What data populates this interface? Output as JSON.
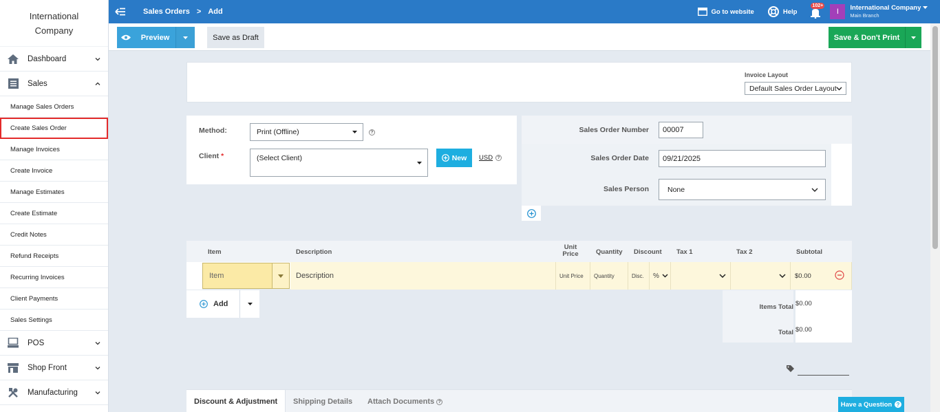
{
  "sidebar": {
    "brand": "International Company",
    "main": [
      {
        "label": "Dashboard",
        "icon": "home-icon"
      },
      {
        "label": "Sales",
        "icon": "list-icon"
      },
      {
        "label": "POS",
        "icon": "monitor-icon"
      },
      {
        "label": "Shop Front",
        "icon": "store-icon"
      },
      {
        "label": "Manufacturing",
        "icon": "tools-icon"
      }
    ],
    "sub": [
      "Manage Sales Orders",
      "Create Sales Order",
      "Manage Invoices",
      "Create Invoice",
      "Manage Estimates",
      "Create Estimate",
      "Credit Notes",
      "Refund Receipts",
      "Recurring Invoices",
      "Client Payments",
      "Sales Settings"
    ]
  },
  "topbar": {
    "crumb_parent": "Sales Orders",
    "crumb_sep": ">",
    "crumb_current": "Add",
    "go_to_website": "Go to website",
    "help": "Help",
    "notif_badge": "102+",
    "avatar": "I",
    "company_name": "International Company",
    "branch": "Main Branch"
  },
  "toolbar": {
    "preview": "Preview",
    "save_draft": "Save as Draft",
    "save_dont_print": "Save & Don't Print"
  },
  "invoice_layout": {
    "label": "Invoice Layout",
    "value": "Default Sales Order Layout"
  },
  "form": {
    "method_label": "Method:",
    "method_value": "Print (Offline)",
    "client_label": "Client",
    "client_req": "*",
    "client_value": "(Select Client)",
    "new_button": "New",
    "currency": "USD",
    "help_mark": "?"
  },
  "sales_order": {
    "number_label": "Sales Order Number",
    "number_value": "00007",
    "date_label": "Sales Order Date",
    "date_value": "09/21/2025",
    "person_label": "Sales Person",
    "person_value": "None"
  },
  "items": {
    "headers": {
      "item": "Item",
      "description": "Description",
      "unit_price": "Unit Price",
      "quantity": "Quantity",
      "discount": "Discount",
      "tax1": "Tax 1",
      "tax2": "Tax 2",
      "subtotal": "Subtotal"
    },
    "row": {
      "item_placeholder": "Item",
      "description_placeholder": "Description",
      "unit_price_placeholder": "Unit Price",
      "quantity_placeholder": "Quantity",
      "discount_placeholder": "Disc.",
      "discount_type": "%",
      "subtotal": "$0.00"
    },
    "add_label": "Add"
  },
  "totals": {
    "items_total_label": "Items Total",
    "items_total_value": "$0.00",
    "total_label": "Total",
    "total_value": "$0.00"
  },
  "tabs": [
    "Discount & Adjustment",
    "Shipping Details",
    "Attach Documents"
  ],
  "have_question": "Have a Question"
}
